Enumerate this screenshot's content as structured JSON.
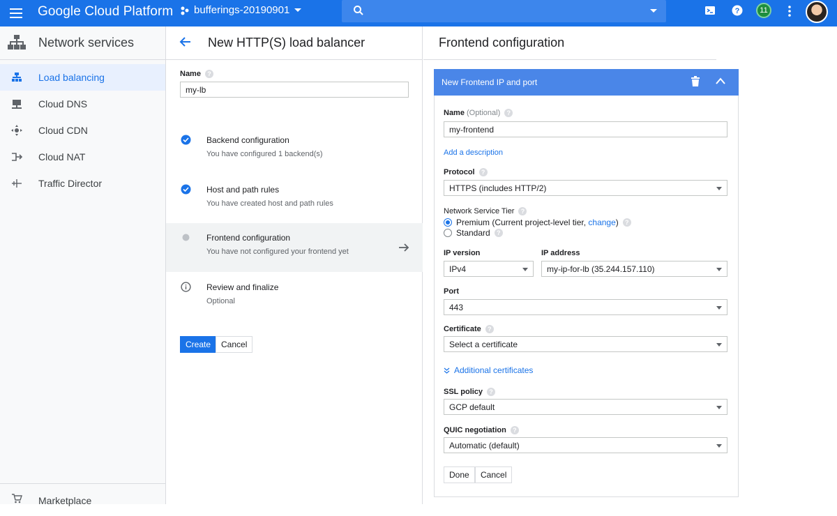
{
  "topbar": {
    "app_title": "Google Cloud Platform",
    "project": "bufferings-20190901",
    "notifications_count": "11",
    "colors": {
      "bar": "#1a73e8",
      "search": "#3d86ec"
    }
  },
  "sidebar": {
    "title": "Network services",
    "items": [
      {
        "label": "Load balancing",
        "icon": "load-balancing-icon",
        "active": true
      },
      {
        "label": "Cloud DNS",
        "icon": "dns-icon"
      },
      {
        "label": "Cloud CDN",
        "icon": "cdn-icon"
      },
      {
        "label": "Cloud NAT",
        "icon": "nat-icon"
      },
      {
        "label": "Traffic Director",
        "icon": "traffic-director-icon"
      }
    ],
    "footer": "Marketplace"
  },
  "middle": {
    "title": "New HTTP(S) load balancer",
    "name_label": "Name",
    "name_value": "my-lb",
    "steps": [
      {
        "title": "Backend configuration",
        "subtitle": "You have configured 1 backend(s)",
        "status": "done"
      },
      {
        "title": "Host and path rules",
        "subtitle": "You have created host and path rules",
        "status": "done"
      },
      {
        "title": "Frontend configuration",
        "subtitle": "You have not configured your frontend yet",
        "status": "current"
      },
      {
        "title": "Review and finalize",
        "subtitle": "Optional",
        "status": "info"
      }
    ],
    "create_label": "Create",
    "cancel_label": "Cancel"
  },
  "right": {
    "title": "Frontend configuration",
    "panel_title": "New Frontend IP and port",
    "name_label": "Name",
    "name_optional": "(Optional)",
    "name_value": "my-frontend",
    "add_description": "Add a description",
    "protocol_label": "Protocol",
    "protocol_value": "HTTPS (includes HTTP/2)",
    "tier_label": "Network Service Tier",
    "tier_premium": "Premium (Current project-level tier,",
    "tier_change": "change",
    "tier_paren": ")",
    "tier_standard": "Standard",
    "ip_version_label": "IP version",
    "ip_version_value": "IPv4",
    "ip_address_label": "IP address",
    "ip_address_value": "my-ip-for-lb (35.244.157.110)",
    "port_label": "Port",
    "port_value": "443",
    "certificate_label": "Certificate",
    "certificate_value": "Select a certificate",
    "additional_certs": "Additional certificates",
    "ssl_label": "SSL policy",
    "ssl_value": "GCP default",
    "quic_label": "QUIC negotiation",
    "quic_value": "Automatic (default)",
    "done_label": "Done",
    "cancel_label": "Cancel"
  }
}
